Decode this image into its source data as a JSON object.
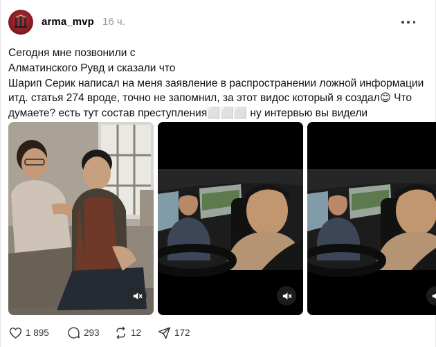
{
  "post": {
    "username": "arma_mvp",
    "time": "16 ч.",
    "text_lines": [
      "Сегодня мне позвонили с",
      "Алматинского Рувд и сказали что",
      "Шарип Серик написал на меня заявление в распространении ложной информации",
      "итд. статья 274 вроде, точно не запомнил, за этот видос который я создал😊 Что",
      "думаете? есть тут состав преступления⬜⬜⬜ ну интервью вы видели"
    ],
    "media": [
      {
        "kind": "image",
        "description_icon": "photo"
      },
      {
        "kind": "video",
        "muted_icon": "speaker-muted-icon"
      },
      {
        "kind": "video",
        "muted_icon": "speaker-muted-icon"
      }
    ]
  },
  "actions": {
    "likes": "1 895",
    "comments": "293",
    "reposts": "12",
    "shares": "172"
  },
  "colors": {
    "avatar": "#8c1d27",
    "time": "#999999",
    "text": "#111111"
  }
}
